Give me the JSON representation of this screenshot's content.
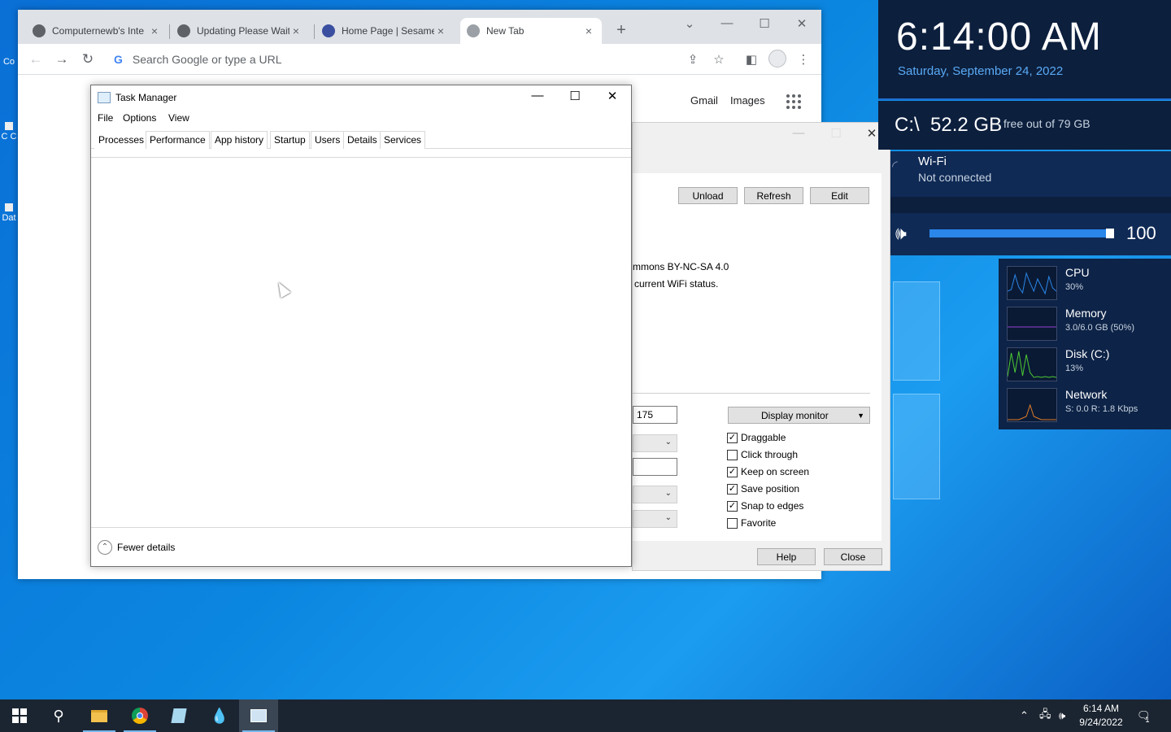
{
  "desktop": {
    "left_icons": [
      "Co",
      "C C",
      "Dat"
    ]
  },
  "chrome": {
    "tabs": [
      {
        "title": "Computernewb's Inte",
        "color": "#5f6368",
        "active": false
      },
      {
        "title": "Updating Please Wait",
        "color": "#5f6368",
        "active": false
      },
      {
        "title": "Home Page | Sesame",
        "color": "#3b4fa0",
        "active": false
      },
      {
        "title": "New Tab",
        "color": "#5f6368",
        "active": true
      }
    ],
    "new_tab_glyph": "+",
    "omnibox_placeholder": "Search Google or type a URL",
    "links": {
      "gmail": "Gmail",
      "images": "Images"
    }
  },
  "rainmeter_settings": {
    "buttons": {
      "unload": "Unload",
      "refresh": "Refresh",
      "edit": "Edit",
      "help": "Help",
      "close": "Close"
    },
    "license_text": "mmons BY-NC-SA 4.0",
    "desc_text": "current WiFi status.",
    "position_value": "175",
    "display_monitor": "Display monitor",
    "checkboxes": [
      {
        "label": "Draggable",
        "checked": true
      },
      {
        "label": "Click through",
        "checked": false
      },
      {
        "label": "Keep on screen",
        "checked": true
      },
      {
        "label": "Save position",
        "checked": true
      },
      {
        "label": "Snap to edges",
        "checked": true
      },
      {
        "label": "Favorite",
        "checked": false
      }
    ]
  },
  "task_manager": {
    "title": "Task Manager",
    "menu": [
      "File",
      "Options",
      "View"
    ],
    "tabs": [
      "Processes",
      "Performance",
      "App history",
      "Startup",
      "Users",
      "Details",
      "Services"
    ],
    "active_tab": "Processes",
    "fewer_details": "Fewer details"
  },
  "widgets": {
    "clock": {
      "time": "6:14:00 AM",
      "date": "Saturday, September 24, 2022"
    },
    "disk": {
      "drive": "C:\\",
      "free": "52.2 GB",
      "total": "free out of 79 GB"
    },
    "wifi": {
      "name": "Wi-Fi",
      "status": "Not connected"
    },
    "volume": {
      "level": 100
    },
    "perf": [
      {
        "name": "CPU",
        "value": "30%",
        "color": "#2a86e8"
      },
      {
        "name": "Memory",
        "value": "3.0/6.0 GB (50%)",
        "color": "#9b3fd1"
      },
      {
        "name": "Disk (C:)",
        "value": "13%",
        "color": "#4cc832"
      },
      {
        "name": "Network",
        "value": "S: 0.0 R: 1.8 Kbps",
        "color": "#e07b28"
      }
    ]
  },
  "taskbar": {
    "time": "6:14 AM",
    "date": "9/24/2022",
    "notifications": "1"
  }
}
